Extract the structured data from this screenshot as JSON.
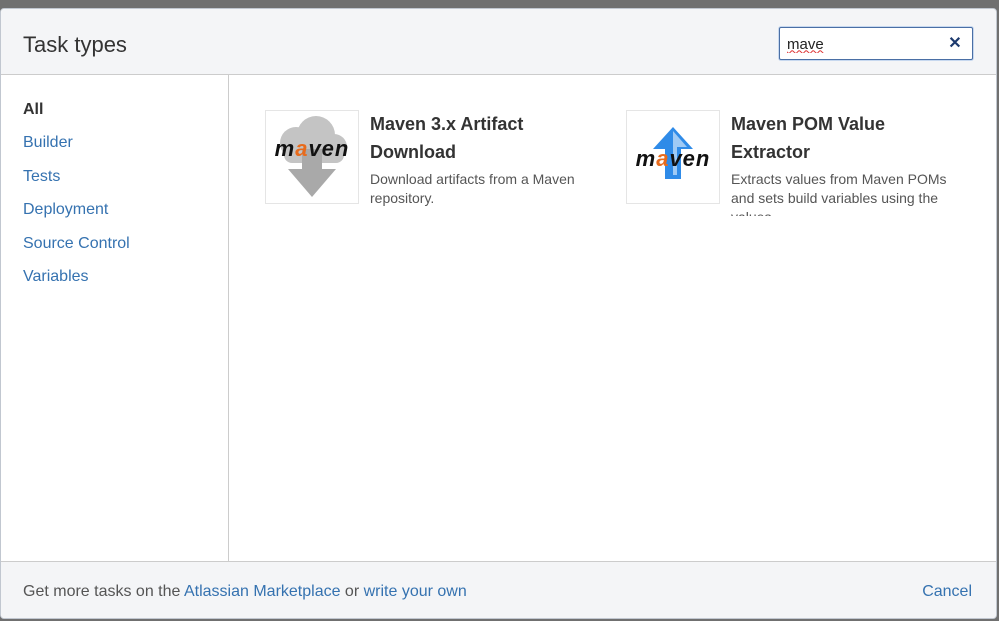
{
  "dialog": {
    "title": "Task types",
    "search": {
      "value": "mave",
      "placeholder": ""
    }
  },
  "sidebar": {
    "items": [
      {
        "label": "All",
        "active": true
      },
      {
        "label": "Builder"
      },
      {
        "label": "Tests"
      },
      {
        "label": "Deployment"
      },
      {
        "label": "Source Control"
      },
      {
        "label": "Variables"
      }
    ]
  },
  "tasks": [
    {
      "title": "Maven 3.x Artifact Download",
      "description": "Download artifacts from a Maven repository.",
      "icon": "maven-download-icon",
      "logo_text": "maven"
    },
    {
      "title": "Maven POM Value Extractor",
      "description": "Extracts values from Maven POMs and sets build variables using the values",
      "icon": "maven-upload-icon",
      "logo_text": "maven"
    }
  ],
  "footer": {
    "prefix": "Get more tasks on the ",
    "marketplace_link": "Atlassian Marketplace",
    "or_text": " or ",
    "write_link": "write your own",
    "cancel_label": "Cancel"
  },
  "colors": {
    "link": "#3572b0",
    "maven_a_orange": "#e86b1c",
    "arrow_blue": "#2f8be8",
    "cloud_gray": "#bdbdbd"
  }
}
